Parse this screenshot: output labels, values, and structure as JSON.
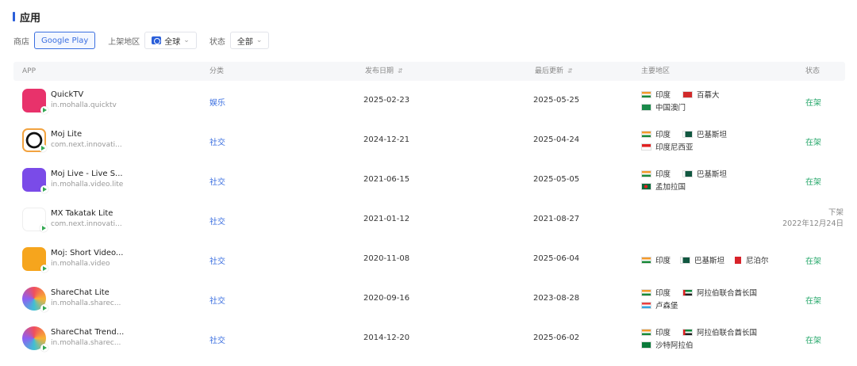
{
  "section": {
    "title": "应用"
  },
  "filters": {
    "store_label": "商店",
    "store_value": "Google Play",
    "region_label": "上架地区",
    "region_value": "全球",
    "status_label": "状态",
    "status_value": "全部"
  },
  "table": {
    "headers": {
      "app": "APP",
      "category": "分类",
      "release_date": "发布日期",
      "last_update": "最后更新",
      "regions": "主要地区",
      "status": "状态"
    },
    "rows": [
      {
        "name": "QuickTV",
        "package": "in.mohalla.quicktv",
        "category": "娱乐",
        "release_date": "2025-02-23",
        "last_update": "2025-05-25",
        "status": "在架",
        "status_date": "",
        "regions": [
          {
            "name": "印度",
            "flag": "india"
          },
          {
            "name": "百慕大",
            "flag": "bermuda"
          },
          {
            "name": "中国澳门",
            "flag": "macau"
          }
        ]
      },
      {
        "name": "Moj Lite",
        "package": "com.next.innovati...",
        "category": "社交",
        "release_date": "2024-12-21",
        "last_update": "2025-04-24",
        "status": "在架",
        "status_date": "",
        "regions": [
          {
            "name": "印度",
            "flag": "india"
          },
          {
            "name": "巴基斯坦",
            "flag": "pakistan"
          },
          {
            "name": "印度尼西亚",
            "flag": "indonesia"
          }
        ]
      },
      {
        "name": "Moj Live - Live S...",
        "package": "in.mohalla.video.lite",
        "category": "社交",
        "release_date": "2021-06-15",
        "last_update": "2025-05-05",
        "status": "在架",
        "status_date": "",
        "regions": [
          {
            "name": "印度",
            "flag": "india"
          },
          {
            "name": "巴基斯坦",
            "flag": "pakistan"
          },
          {
            "name": "孟加拉国",
            "flag": "bangladesh"
          }
        ]
      },
      {
        "name": "MX Takatak Lite",
        "package": "com.next.innovati...",
        "category": "社交",
        "release_date": "2021-01-12",
        "last_update": "2021-08-27",
        "status": "下架",
        "status_date": "2022年12月24日",
        "regions": []
      },
      {
        "name": "Moj: Short Video...",
        "package": "in.mohalla.video",
        "category": "社交",
        "release_date": "2020-11-08",
        "last_update": "2025-06-04",
        "status": "在架",
        "status_date": "",
        "regions": [
          {
            "name": "印度",
            "flag": "india"
          },
          {
            "name": "巴基斯坦",
            "flag": "pakistan"
          },
          {
            "name": "尼泊尔",
            "flag": "nepal"
          }
        ]
      },
      {
        "name": "ShareChat Lite",
        "package": "in.mohalla.sharec...",
        "category": "社交",
        "release_date": "2020-09-16",
        "last_update": "2023-08-28",
        "status": "在架",
        "status_date": "",
        "regions": [
          {
            "name": "印度",
            "flag": "india"
          },
          {
            "name": "阿拉伯联合酋长国",
            "flag": "uae"
          },
          {
            "name": "卢森堡",
            "flag": "luxembourg"
          }
        ]
      },
      {
        "name": "ShareChat Trend...",
        "package": "in.mohalla.sharec...",
        "category": "社交",
        "release_date": "2014-12-20",
        "last_update": "2025-06-02",
        "status": "在架",
        "status_date": "",
        "regions": [
          {
            "name": "印度",
            "flag": "india"
          },
          {
            "name": "阿拉伯联合酋长国",
            "flag": "uae"
          },
          {
            "name": "沙特阿拉伯",
            "flag": "saudi"
          }
        ]
      }
    ]
  },
  "colors": {
    "accent": "#3b6fe0",
    "status_on": "#27a86b",
    "status_off": "#888888"
  }
}
